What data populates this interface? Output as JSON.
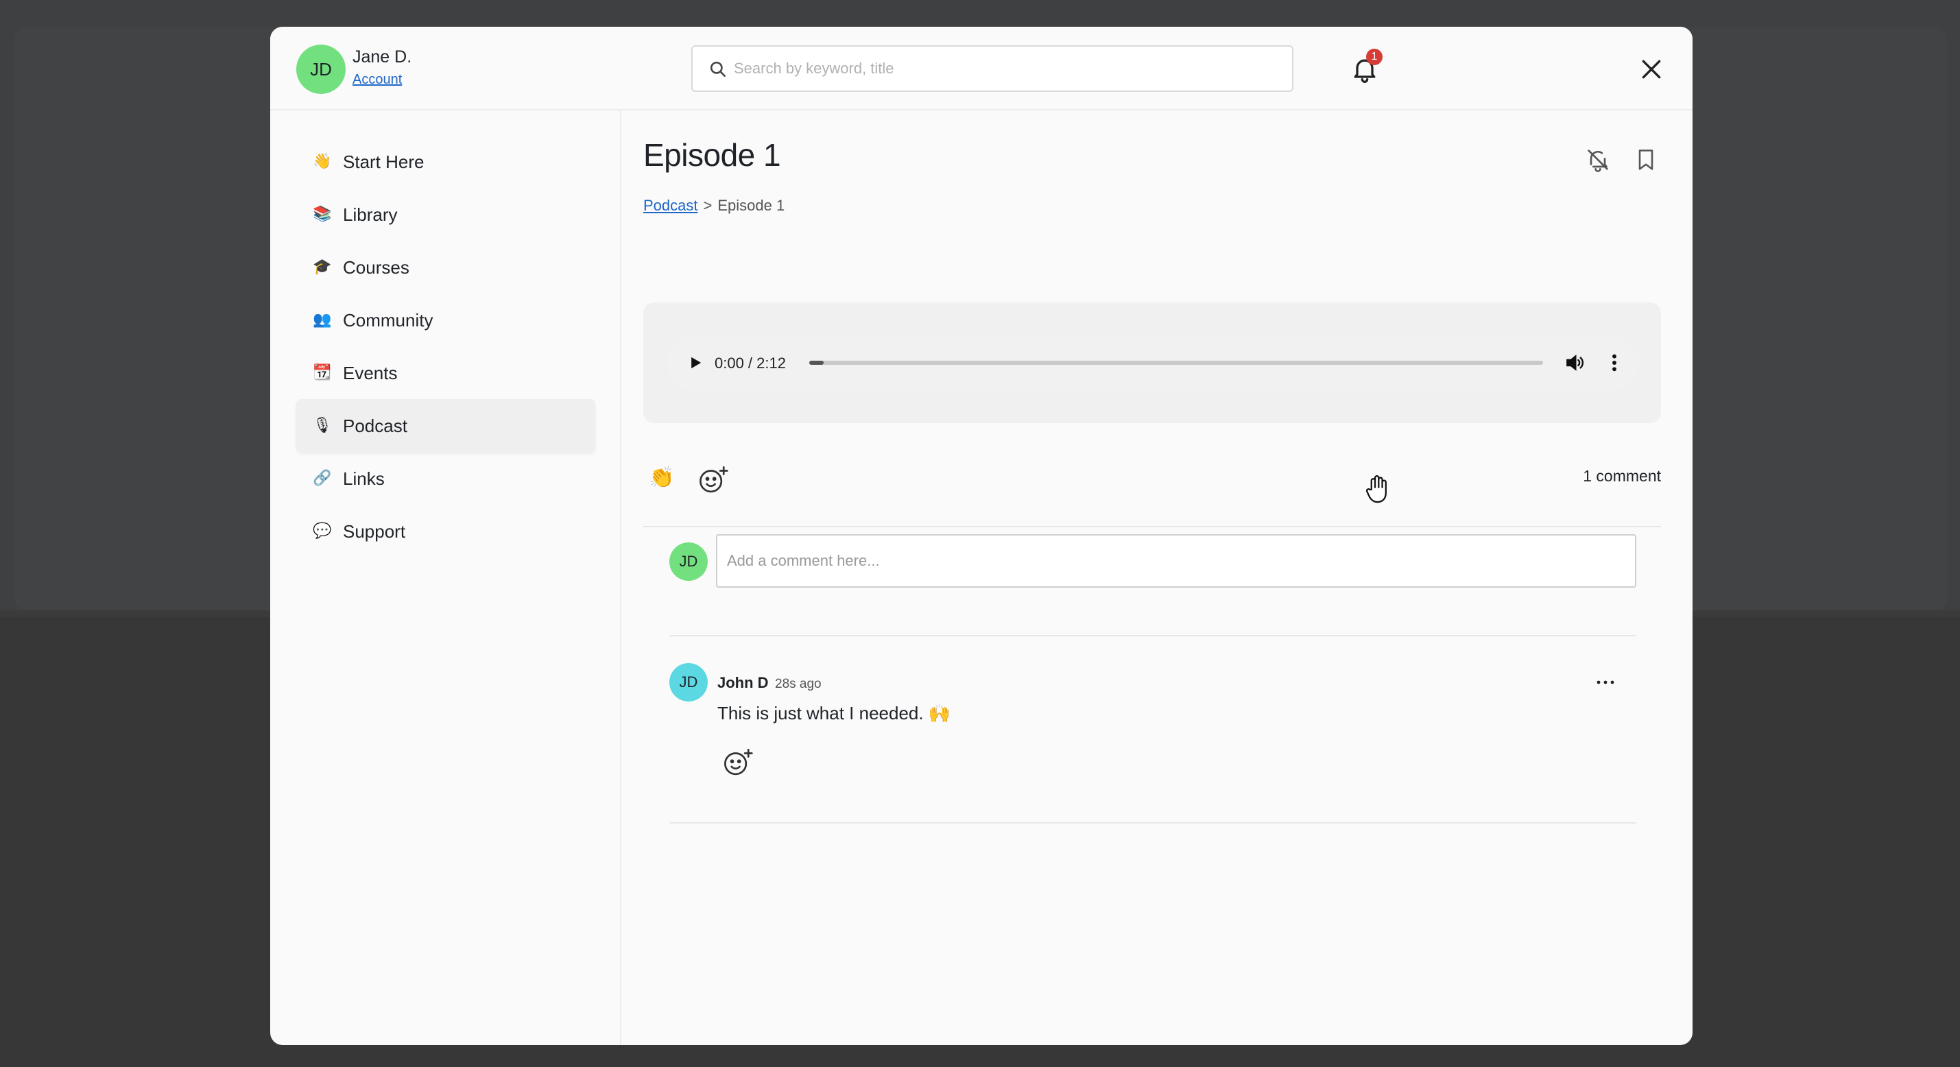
{
  "user": {
    "initials": "JD",
    "name": "Jane D.",
    "account_link": "Account"
  },
  "search": {
    "placeholder": "Search by keyword, title",
    "value": ""
  },
  "notifications": {
    "count": "1"
  },
  "sidebar": {
    "items": [
      {
        "emoji": "👋",
        "label": "Start Here",
        "icon": "wave-icon"
      },
      {
        "emoji": "📚",
        "label": "Library",
        "icon": "books-icon"
      },
      {
        "emoji": "🎓",
        "label": "Courses",
        "icon": "grad-cap-icon"
      },
      {
        "emoji": "👥",
        "label": "Community",
        "icon": "people-icon"
      },
      {
        "emoji": "📆",
        "label": "Events",
        "icon": "calendar-icon"
      },
      {
        "emoji": "🎙",
        "label": "Podcast",
        "icon": "microphone-icon",
        "active": true
      },
      {
        "emoji": "🔗",
        "label": "Links",
        "icon": "link-icon"
      },
      {
        "emoji": "💬",
        "label": "Support",
        "icon": "speech-bubble-icon"
      }
    ]
  },
  "page": {
    "title": "Episode 1",
    "breadcrumb": {
      "parent": "Podcast",
      "separator": ">",
      "current": "Episode 1"
    }
  },
  "player": {
    "time": "0:00 / 2:12",
    "progress": 0.0
  },
  "reactions": {
    "clap_emoji": "👏",
    "comment_count": "1 comment"
  },
  "comment_form": {
    "initials": "JD",
    "placeholder": "Add a comment here..."
  },
  "comments": [
    {
      "initials": "JD",
      "author": "John D",
      "time": "28s ago",
      "body": "This is just what I needed. 🙌"
    }
  ],
  "colors": {
    "accent_link": "#1e66c8",
    "avatar_self": "#72e07f",
    "avatar_other": "#5cd8e2",
    "badge": "#d63c35"
  }
}
